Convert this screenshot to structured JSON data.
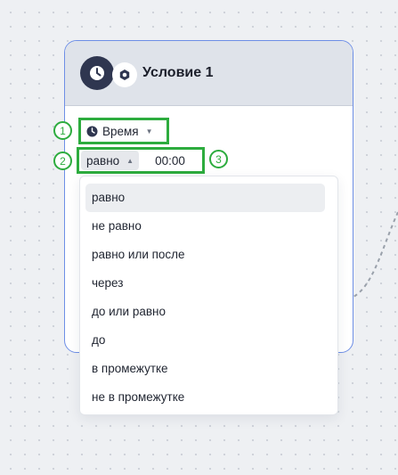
{
  "node": {
    "title": "Условие 1"
  },
  "field": {
    "label": "Время"
  },
  "operator": {
    "selected": "равно"
  },
  "time": {
    "value": "00:00"
  },
  "badges": [
    "1",
    "2",
    "3"
  ],
  "dropdown": {
    "options": [
      "равно",
      "не равно",
      "равно или после",
      "через",
      "до или равно",
      "до",
      "в промежутке",
      "не в промежутке"
    ],
    "selected_index": 0
  },
  "colors": {
    "highlight": "#2dac3e",
    "node_border": "#6e8fe6",
    "icon_dark": "#2f3650"
  },
  "icons": {
    "node": "clock-icon",
    "secondary": "settings-icon",
    "field": "clock-icon"
  }
}
